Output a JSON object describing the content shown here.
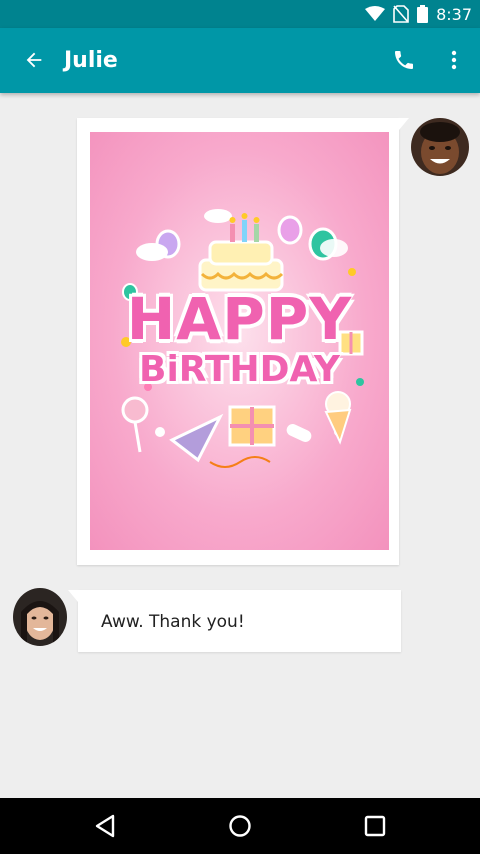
{
  "status_bar": {
    "time": "8:37",
    "icons": [
      "wifi-icon",
      "no-sim-icon",
      "battery-icon"
    ]
  },
  "app_bar": {
    "title": "Julie",
    "back_icon": "arrow-back-icon",
    "actions": [
      "phone-icon",
      "more-vert-icon"
    ],
    "color": "#0097a7"
  },
  "conversation": {
    "messages": [
      {
        "sender": "me",
        "type": "image",
        "image_text_line1": "HAPPY",
        "image_text_line2": "BiRTHDAY"
      },
      {
        "sender": "Julie",
        "type": "text",
        "text": "Aww. Thank you!"
      }
    ]
  },
  "nav_bar": {
    "buttons": [
      "back-nav-icon",
      "home-nav-icon",
      "recents-nav-icon"
    ]
  }
}
